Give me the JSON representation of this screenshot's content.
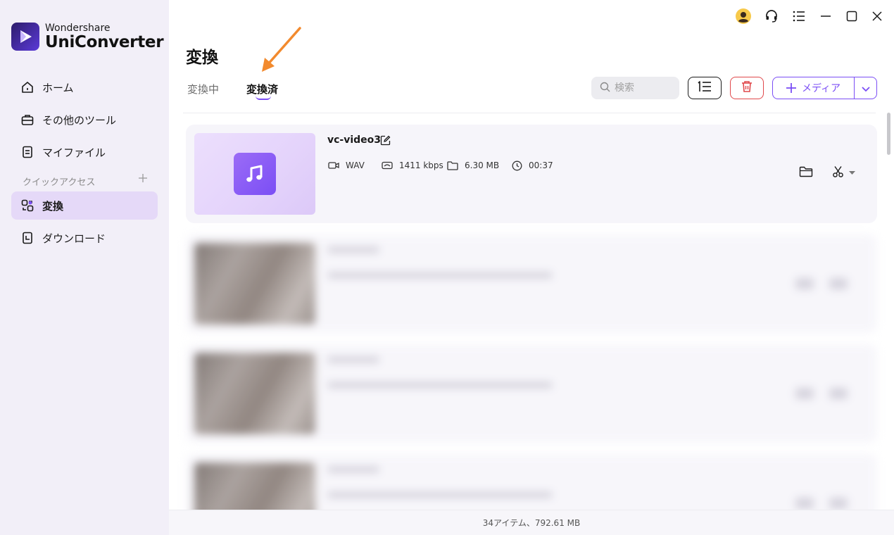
{
  "app": {
    "brand": "Wondershare",
    "product": "UniConverter"
  },
  "sidebar": {
    "items": [
      {
        "label": "ホーム",
        "icon": "home-icon"
      },
      {
        "label": "その他のツール",
        "icon": "toolbox-icon"
      },
      {
        "label": "マイファイル",
        "icon": "file-icon"
      }
    ],
    "quick_access_label": "クイックアクセス",
    "quick_items": [
      {
        "label": "変換",
        "icon": "convert-icon",
        "active": true
      },
      {
        "label": "ダウンロード",
        "icon": "download-icon"
      }
    ]
  },
  "window_controls": [
    "avatar-icon",
    "headset-icon",
    "menu-icon",
    "minimize-icon",
    "maximize-icon",
    "close-icon"
  ],
  "main": {
    "title": "変換",
    "tabs": [
      {
        "label": "変換中",
        "active": false
      },
      {
        "label": "変換済",
        "active": true
      }
    ],
    "search": {
      "placeholder": "検索"
    },
    "add_media_label": "メディア"
  },
  "files": [
    {
      "name": "vc-video3",
      "format": "WAV",
      "bitrate": "1411 kbps",
      "size": "6.30 MB",
      "duration": "00:37"
    }
  ],
  "status": {
    "summary": "34アイテム、792.61 MB"
  },
  "colors": {
    "accent": "#7b4ef5",
    "danger": "#e0484b",
    "sidebar_bg": "#f2eff8",
    "active_nav": "#e5d9f8",
    "annotation_arrow": "#f28a2e"
  }
}
